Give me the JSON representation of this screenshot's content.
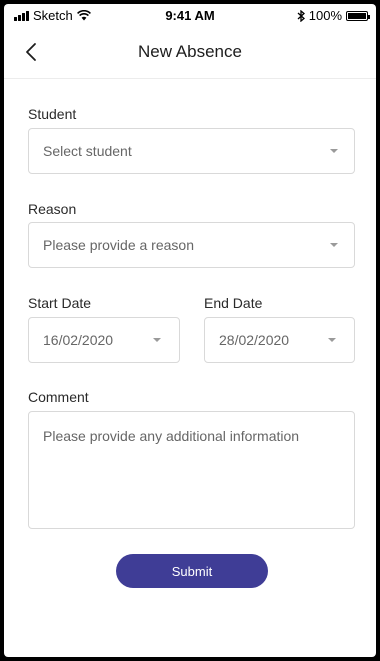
{
  "status_bar": {
    "carrier": "Sketch",
    "time": "9:41 AM",
    "battery": "100%",
    "icons": [
      "signal-bars-icon",
      "wifi-icon",
      "bluetooth-icon",
      "battery-icon"
    ]
  },
  "header": {
    "title": "New Absence",
    "back_icon": "chevron-left-icon"
  },
  "form": {
    "student": {
      "label": "Student",
      "placeholder": "Select student"
    },
    "reason": {
      "label": "Reason",
      "placeholder": "Please provide a reason"
    },
    "start_date": {
      "label": "Start Date",
      "value": "16/02/2020"
    },
    "end_date": {
      "label": "End Date",
      "value": "28/02/2020"
    },
    "comment": {
      "label": "Comment",
      "placeholder": "Please provide any additional information"
    },
    "submit_label": "Submit"
  },
  "colors": {
    "accent": "#3f3d96",
    "border": "#d9d9d9",
    "placeholder": "#666666"
  }
}
